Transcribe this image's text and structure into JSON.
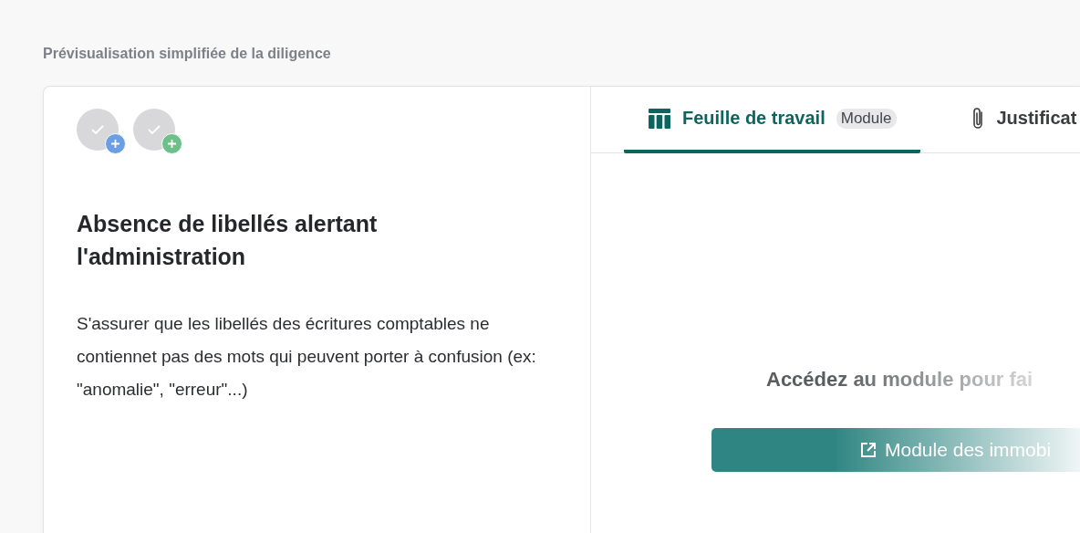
{
  "heading": "Prévisualisation simplifiée de la diligence",
  "assignees": [
    {
      "color": "#6a9fe6"
    },
    {
      "color": "#6cc08a"
    }
  ],
  "title": "Absence de libellés alertant l'administration",
  "description": "S'assurer que les libellés des écritures comptables ne contiennet pas des mots qui peuvent porter à confusion (ex: \"anomalie\", \"erreur\"...)",
  "tabs": [
    {
      "kind": "table",
      "label": "Feuille de travail",
      "badge": "Module",
      "selected": true
    },
    {
      "kind": "paperclip",
      "label": "Justificat",
      "selected": false
    }
  ],
  "module_card": {
    "message": "Accédez au module pour fai",
    "button": "Module des immobi"
  }
}
